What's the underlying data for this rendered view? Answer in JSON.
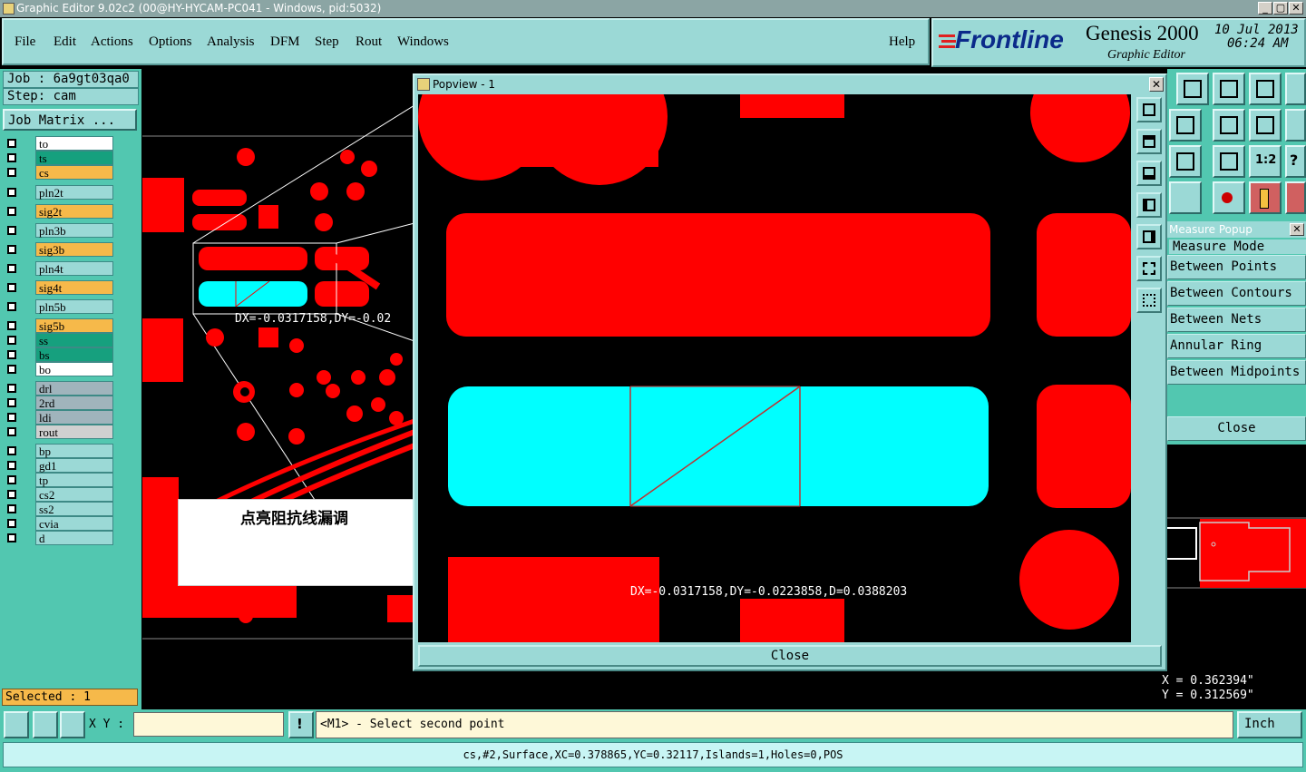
{
  "window": {
    "title": "Graphic Editor 9.02c2 (00@HY-HYCAM-PC041 - Windows, pid:5032)"
  },
  "menu": [
    "File",
    "Edit",
    "Actions",
    "Options",
    "Analysis",
    "DFM",
    "Step",
    "Rout",
    "Windows"
  ],
  "help_label": "Help",
  "brand": {
    "logo": "Frontline",
    "product": "Genesis 2000",
    "subtitle": "Graphic Editor",
    "date": "10 Jul 2013",
    "time": "06:24 AM"
  },
  "job": {
    "job_line": "Job : 6a9gt03qa0",
    "step_line": "Step: cam",
    "matrix_button": "Job Matrix ..."
  },
  "layers": [
    {
      "name": "to",
      "color": "#ffffff"
    },
    {
      "name": "ts",
      "color": "#16a07e"
    },
    {
      "name": "cs",
      "color": "#f6b94a"
    },
    {
      "name": "pln2t",
      "color": "#9bd9d6"
    },
    {
      "name": "sig2t",
      "color": "#f6b94a"
    },
    {
      "name": "pln3b",
      "color": "#9bd9d6"
    },
    {
      "name": "sig3b",
      "color": "#f6b94a"
    },
    {
      "name": "pln4t",
      "color": "#9bd9d6"
    },
    {
      "name": "sig4t",
      "color": "#f6b94a"
    },
    {
      "name": "pln5b",
      "color": "#9bd9d6"
    },
    {
      "name": "sig5b",
      "color": "#f6b94a"
    },
    {
      "name": "ss",
      "color": "#16a07e"
    },
    {
      "name": "bs",
      "color": "#16a07e"
    },
    {
      "name": "bo",
      "color": "#ffffff"
    },
    {
      "name": "drl",
      "color": "#a0b4bc"
    },
    {
      "name": "2rd",
      "color": "#a0b4bc"
    },
    {
      "name": "ldi",
      "color": "#a0b4bc"
    },
    {
      "name": "rout",
      "color": "#d0d0d0"
    },
    {
      "name": "bp",
      "color": "#9bd9d6"
    },
    {
      "name": "gd1",
      "color": "#9bd9d6"
    },
    {
      "name": "tp",
      "color": "#9bd9d6"
    },
    {
      "name": "cs2",
      "color": "#9bd9d6"
    },
    {
      "name": "ss2",
      "color": "#9bd9d6"
    },
    {
      "name": "cvia",
      "color": "#9bd9d6"
    },
    {
      "name": "d",
      "color": "#9bd9d6"
    }
  ],
  "selected_label": "Selected : 1",
  "canvas_measure": "DX=-0.0317158,DY=-0.02",
  "annotation": "点亮阻抗线漏调",
  "popview": {
    "title": "Popview - 1",
    "measure_text": "DX=-0.0317158,DY=-0.0223858,D=0.0388203",
    "close_label": "Close"
  },
  "measure_popup": {
    "title": "Measure Popup",
    "items": [
      "Measure Mode",
      "Between Points",
      "Between Contours",
      "Between Nets",
      "Annular Ring",
      "Between Midpoints"
    ],
    "close_label": "Close"
  },
  "coords": {
    "x": "X = 0.362394\"",
    "y": "Y = 0.312569\""
  },
  "xy_label": "X Y :",
  "xy_input": "",
  "prompt": "<M1> - Select second point",
  "units": "Inch",
  "status": "cs,#2,Surface,XC=0.378865,YC=0.32117,Islands=1,Holes=0,POS",
  "tool_labels": [
    "1:2"
  ],
  "colors": {
    "copper": "#ff0000",
    "highlight": "#00ffff",
    "panel": "#9bd9d6",
    "panel_dark": "#52c7b0"
  }
}
